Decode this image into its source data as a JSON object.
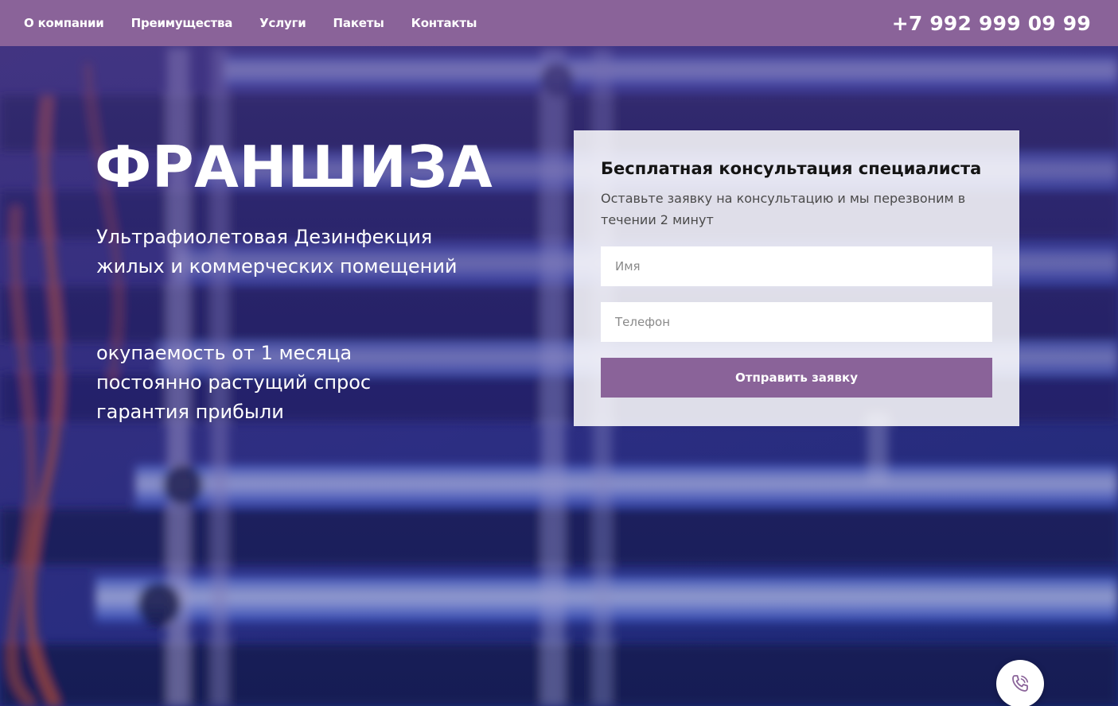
{
  "nav": {
    "items": [
      {
        "label": "О компании"
      },
      {
        "label": "Преимущества"
      },
      {
        "label": "Услуги"
      },
      {
        "label": "Пакеты"
      },
      {
        "label": "Контакты"
      }
    ],
    "phone": "+7 992 999 09 99"
  },
  "hero": {
    "title": "ФРАНШИЗА",
    "subtitle_line1": "Ультрафиолетовая Дезинфекция",
    "subtitle_line2": "жилых и коммерческих помещений",
    "benefits": [
      "окупаемость от 1 месяца",
      "постоянно растущий спрос",
      "гарантия прибыли"
    ]
  },
  "form": {
    "title": "Бесплатная консультация специалиста",
    "description": "Оставьте заявку на консультацию и мы перезвоним в течении 2 минут",
    "name_placeholder": "Имя",
    "phone_placeholder": "Телефон",
    "submit_label": "Отправить заявку"
  },
  "call_button": {
    "icon": "phone-call-icon"
  },
  "colors": {
    "brand": "#8a6399",
    "background": "#2c2464",
    "uv_glow": "#6f8cf0"
  }
}
